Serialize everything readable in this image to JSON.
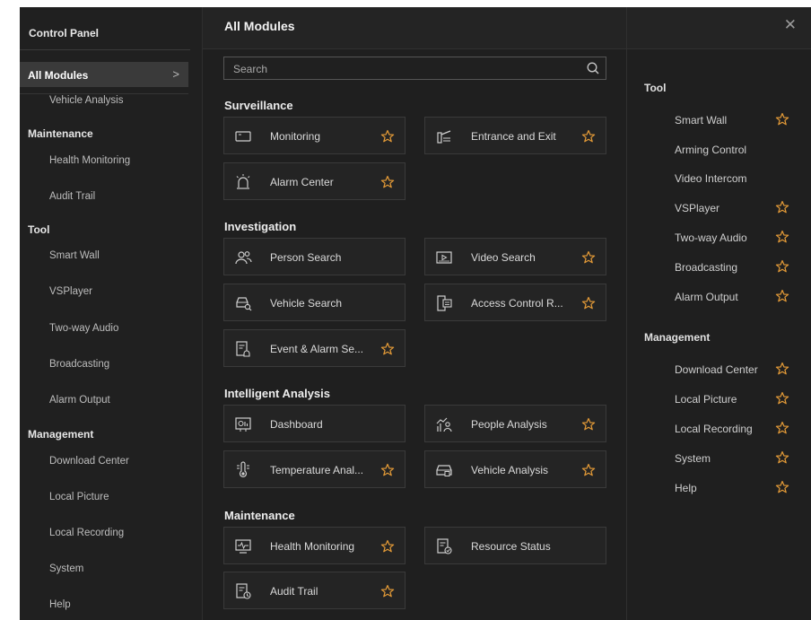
{
  "colors": {
    "accent_star": "#e39a37",
    "background": "#1f1f1f",
    "active_item": "#3a3a3a"
  },
  "sidebar": {
    "title": "Control Panel",
    "active": {
      "label": "All Modules",
      "chevron": ">"
    },
    "items": [
      {
        "label": "Vehicle Analysis",
        "kind": "sub"
      },
      {
        "label": "Maintenance",
        "kind": "cat"
      },
      {
        "label": "Health Monitoring",
        "kind": "sub"
      },
      {
        "label": "Audit Trail",
        "kind": "sub"
      },
      {
        "label": "Tool",
        "kind": "cat"
      },
      {
        "label": "Smart Wall",
        "kind": "sub"
      },
      {
        "label": "VSPlayer",
        "kind": "sub"
      },
      {
        "label": "Two-way Audio",
        "kind": "sub"
      },
      {
        "label": "Broadcasting",
        "kind": "sub"
      },
      {
        "label": "Alarm Output",
        "kind": "sub"
      },
      {
        "label": "Management",
        "kind": "cat"
      },
      {
        "label": "Download Center",
        "kind": "sub"
      },
      {
        "label": "Local Picture",
        "kind": "sub"
      },
      {
        "label": "Local Recording",
        "kind": "sub"
      },
      {
        "label": "System",
        "kind": "sub"
      },
      {
        "label": "Help",
        "kind": "sub"
      }
    ]
  },
  "header": {
    "title": "All Modules",
    "close_icon": "close-icon"
  },
  "search": {
    "placeholder": "Search",
    "value": ""
  },
  "sections": [
    {
      "title": "Surveillance",
      "cards": [
        {
          "label": "Monitoring",
          "icon": "monitor-icon",
          "star": true
        },
        {
          "label": "Entrance and Exit",
          "icon": "barrier-gate-icon",
          "star": true
        },
        {
          "label": "Alarm Center",
          "icon": "alarm-icon",
          "star": true
        }
      ]
    },
    {
      "title": "Investigation",
      "cards": [
        {
          "label": "Person Search",
          "icon": "person-search-icon",
          "star": false
        },
        {
          "label": "Video Search",
          "icon": "video-search-icon",
          "star": true
        },
        {
          "label": "Vehicle Search",
          "icon": "vehicle-search-icon",
          "star": false
        },
        {
          "label": "Access Control R...",
          "icon": "access-control-icon",
          "star": true
        },
        {
          "label": "Event & Alarm Se...",
          "icon": "event-alarm-icon",
          "star": true
        }
      ]
    },
    {
      "title": "Intelligent Analysis",
      "cards": [
        {
          "label": "Dashboard",
          "icon": "dashboard-icon",
          "star": false
        },
        {
          "label": "People Analysis",
          "icon": "people-analysis-icon",
          "star": true
        },
        {
          "label": "Temperature Anal...",
          "icon": "temperature-icon",
          "star": true
        },
        {
          "label": "Vehicle Analysis",
          "icon": "vehicle-analysis-icon",
          "star": true
        }
      ]
    },
    {
      "title": "Maintenance",
      "cards": [
        {
          "label": "Health Monitoring",
          "icon": "health-monitor-icon",
          "star": true
        },
        {
          "label": "Resource Status",
          "icon": "resource-status-icon",
          "star": false
        },
        {
          "label": "Audit Trail",
          "icon": "audit-trail-icon",
          "star": true
        }
      ]
    }
  ],
  "right_panel": {
    "groups": [
      {
        "title": "Tool",
        "items": [
          {
            "label": "Smart Wall",
            "star": true
          },
          {
            "label": "Arming Control",
            "star": false
          },
          {
            "label": "Video Intercom",
            "star": false
          },
          {
            "label": "VSPlayer",
            "star": true
          },
          {
            "label": "Two-way Audio",
            "star": true
          },
          {
            "label": "Broadcasting",
            "star": true
          },
          {
            "label": "Alarm Output",
            "star": true
          }
        ]
      },
      {
        "title": "Management",
        "items": [
          {
            "label": "Download Center",
            "star": true
          },
          {
            "label": "Local Picture",
            "star": true
          },
          {
            "label": "Local Recording",
            "star": true
          },
          {
            "label": "System",
            "star": true
          },
          {
            "label": "Help",
            "star": true
          }
        ]
      }
    ]
  }
}
